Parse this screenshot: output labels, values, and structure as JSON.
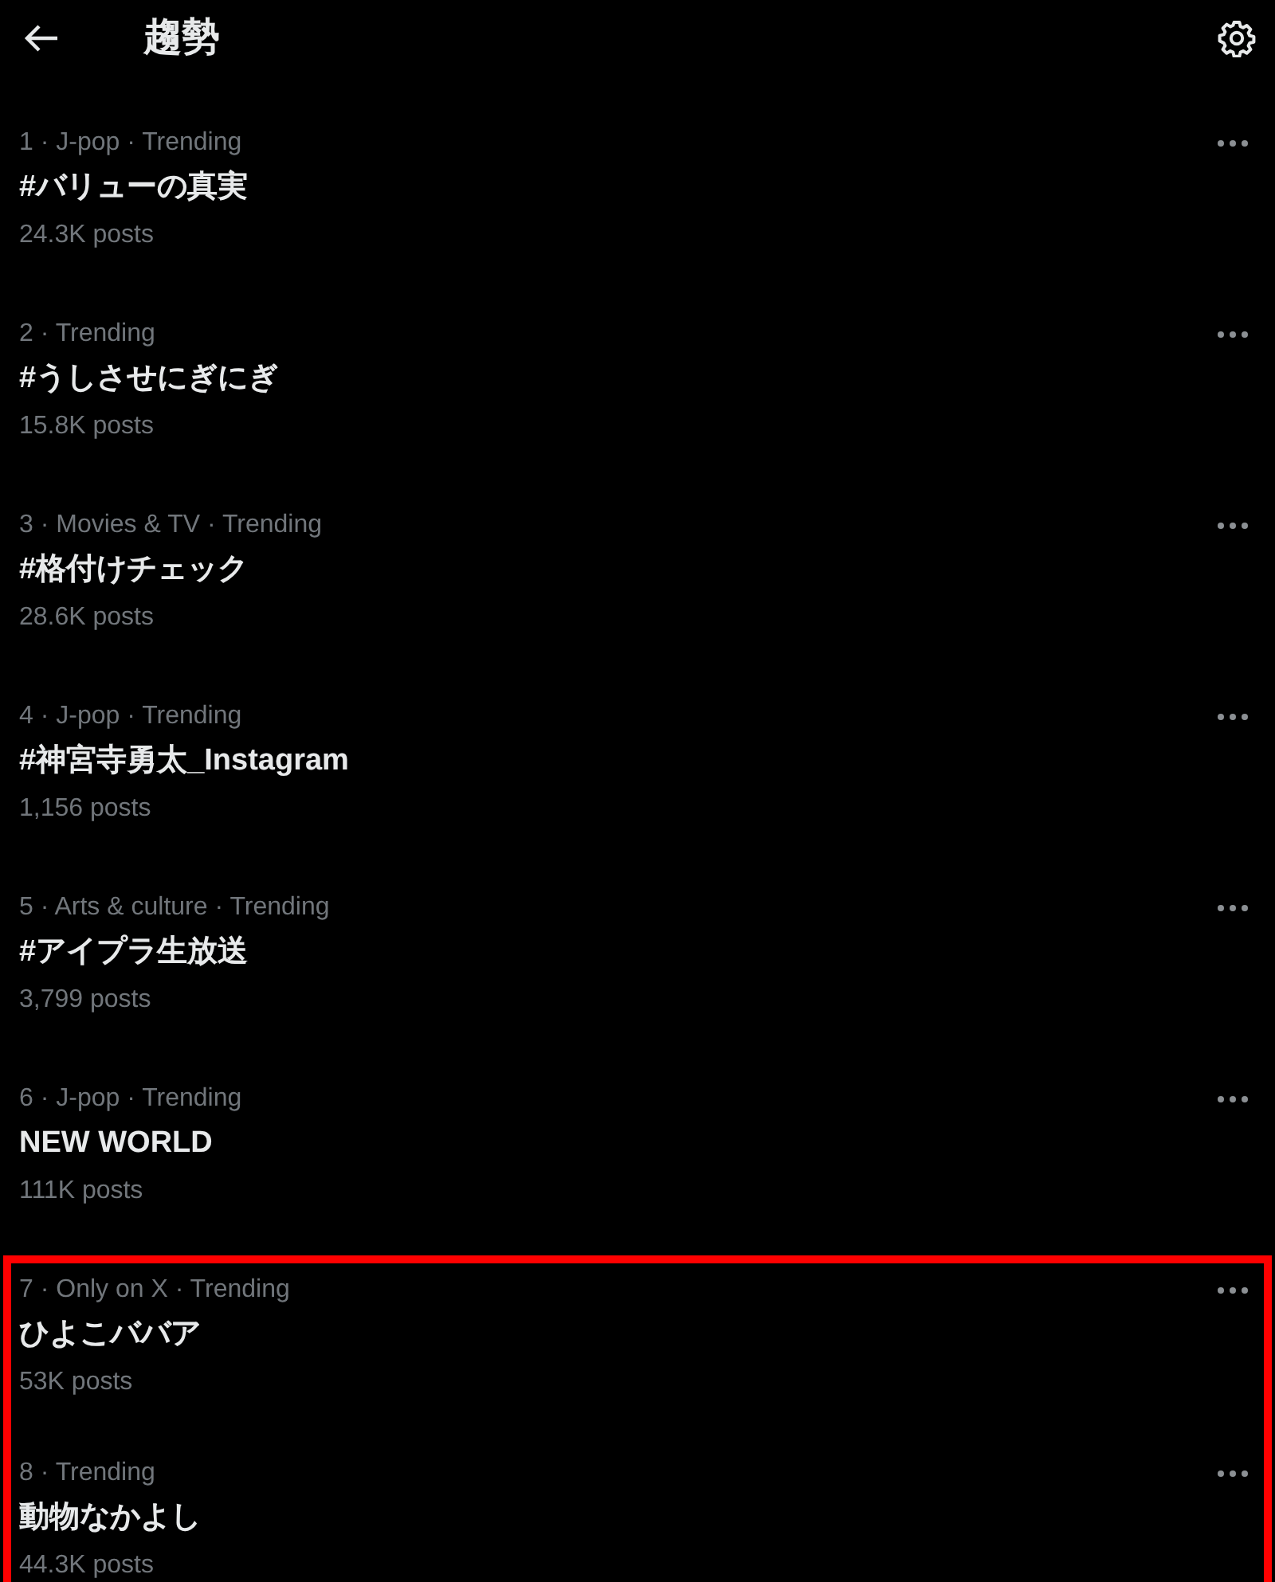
{
  "header": {
    "title": "趨勢"
  },
  "trends": [
    {
      "meta": "1 · J-pop · Trending",
      "title": "#バリューの真実",
      "posts": "24.3K posts",
      "highlighted": false
    },
    {
      "meta": "2 · Trending",
      "title": "#うしさせにぎにぎ",
      "posts": "15.8K posts",
      "highlighted": false
    },
    {
      "meta": "3 · Movies & TV · Trending",
      "title": "#格付けチェック",
      "posts": "28.6K posts",
      "highlighted": false
    },
    {
      "meta": "4 · J-pop · Trending",
      "title": "#神宮寺勇太_Instagram",
      "posts": "1,156 posts",
      "highlighted": false
    },
    {
      "meta": "5 · Arts & culture · Trending",
      "title": "#アイプラ生放送",
      "posts": "3,799 posts",
      "highlighted": false
    },
    {
      "meta": "6 · J-pop · Trending",
      "title": "NEW WORLD",
      "posts": "111K posts",
      "highlighted": false
    },
    {
      "meta": "7 · Only on X · Trending",
      "title": "ひよこババア",
      "posts": "53K posts",
      "highlighted": true
    },
    {
      "meta": "8 · Trending",
      "title": "動物なかよし",
      "posts": "44.3K posts",
      "highlighted": true
    }
  ]
}
